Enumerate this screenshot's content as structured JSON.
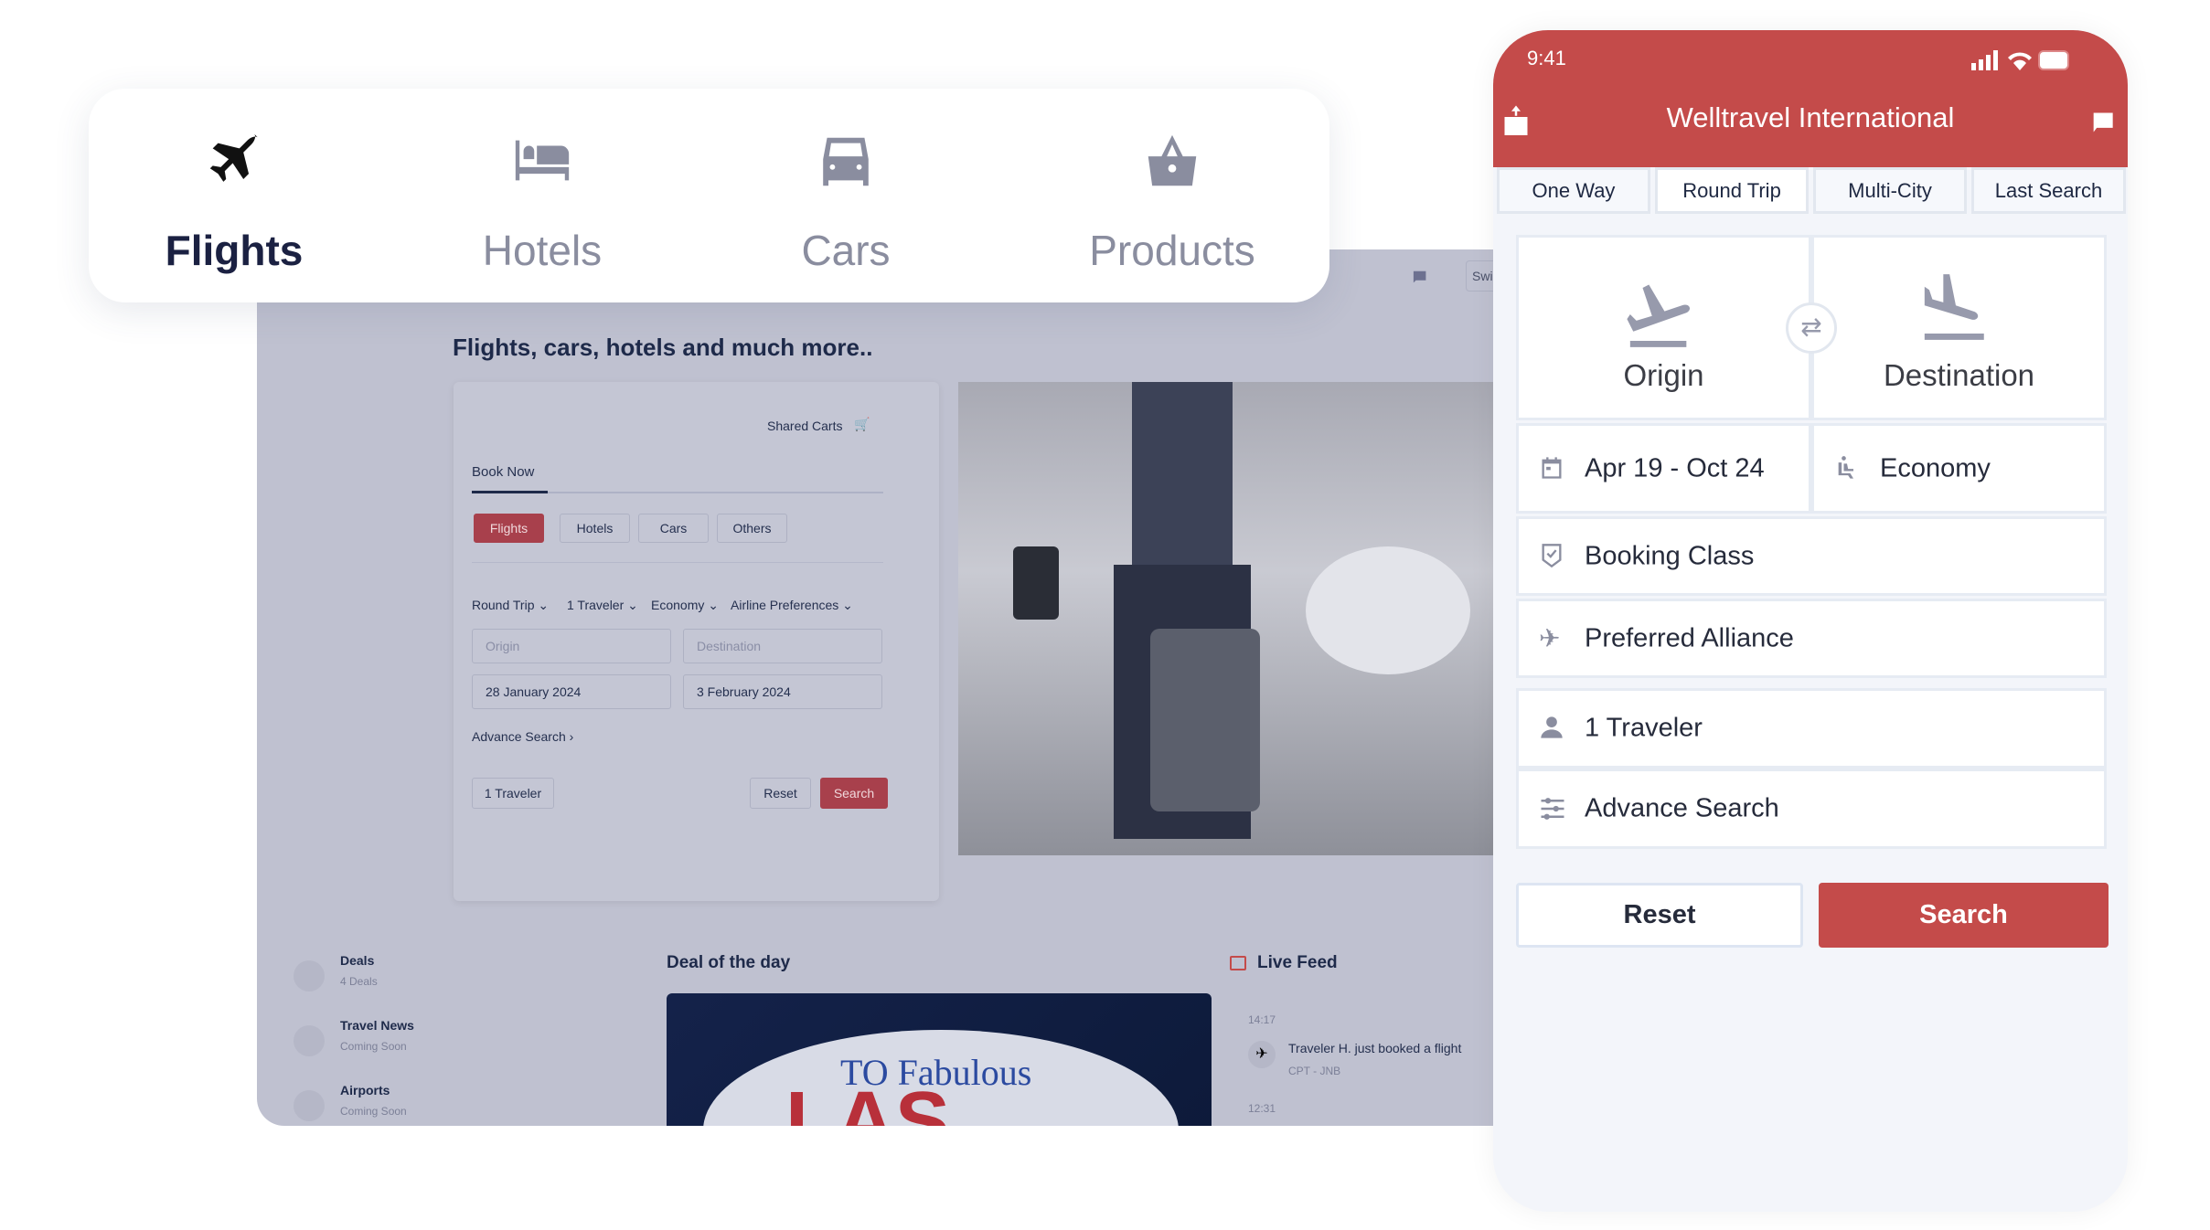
{
  "top_tabs": [
    {
      "label": "Flights",
      "icon": "plane-icon",
      "active": true
    },
    {
      "label": "Hotels",
      "icon": "bed-icon"
    },
    {
      "label": "Cars",
      "icon": "car-icon"
    },
    {
      "label": "Products",
      "icon": "basket-icon"
    }
  ],
  "desktop": {
    "switch_label": "Swi",
    "heading": "Flights, cars, hotels and much more..",
    "shared_carts": "Shared Carts",
    "book_now": "Book Now",
    "product_tabs": [
      "Flights",
      "Hotels",
      "Cars",
      "Others"
    ],
    "options": [
      "Round Trip",
      "1 Traveler",
      "Economy",
      "Airline Preferences"
    ],
    "origin_placeholder": "Origin",
    "destination_placeholder": "Destination",
    "date_from": "28 January 2024",
    "date_to": "3 February 2024",
    "advance_search": "Advance Search",
    "traveler": "1 Traveler",
    "reset": "Reset",
    "search": "Search",
    "side": [
      {
        "title": "Deals",
        "sub": "4 Deals"
      },
      {
        "title": "Travel News",
        "sub": "Coming Soon"
      },
      {
        "title": "Airports",
        "sub": "Coming Soon"
      }
    ],
    "deal_title": "Deal of the day",
    "live_feed": {
      "title": "Live Feed",
      "items": [
        {
          "time": "14:17",
          "text": "Traveler H. just booked a flight",
          "route": "CPT - JNB"
        },
        {
          "time": "12:31"
        }
      ]
    }
  },
  "phone": {
    "time": "9:41",
    "title": "Welltravel International",
    "trip_tabs": [
      "One Way",
      "Round Trip",
      "Multi-City",
      "Last Search"
    ],
    "selected_tab": "Round Trip",
    "origin": "Origin",
    "destination": "Destination",
    "dates": "Apr 19 - Oct 24",
    "cabin": "Economy",
    "booking_class": "Booking Class",
    "alliance": "Preferred Alliance",
    "traveler": "1 Traveler",
    "advance": "Advance Search",
    "reset": "Reset",
    "search": "Search"
  },
  "colors": {
    "brand_red": "#c44b4a",
    "navy": "#1b2142",
    "icon_gray": "#8a8d9f"
  }
}
